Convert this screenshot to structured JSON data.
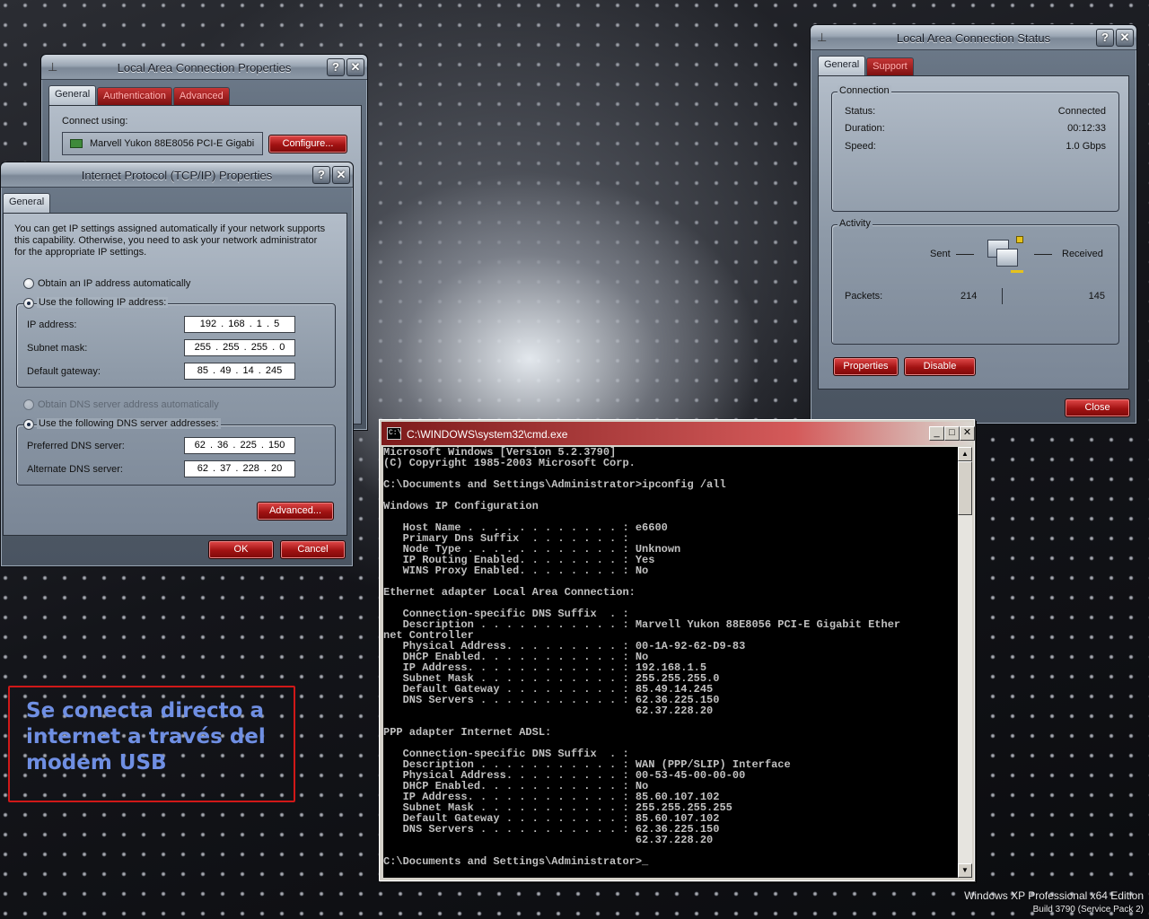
{
  "lan_properties": {
    "title": "Local Area Connection Properties",
    "tabs": [
      "General",
      "Authentication",
      "Advanced"
    ],
    "connect_using_label": "Connect using:",
    "adapter": "Marvell Yukon 88E8056 PCI-E Gigabi",
    "configure_button": "Configure..."
  },
  "tcpip": {
    "title": "Internet Protocol (TCP/IP) Properties",
    "tab": "General",
    "description": "You can get IP settings assigned automatically if your network supports this capability. Otherwise, you need to ask your network administrator for the appropriate IP settings.",
    "radio_auto_ip": "Obtain an IP address automatically",
    "radio_manual_ip": "Use the following IP address:",
    "ip_label": "IP address:",
    "ip_value": "192 . 168 .  1  .  5",
    "subnet_label": "Subnet mask:",
    "subnet_value": "255 . 255 . 255 .  0",
    "gateway_label": "Default gateway:",
    "gateway_value": "85  .  49  .  14  . 245",
    "radio_auto_dns": "Obtain DNS server address automatically",
    "radio_manual_dns": "Use the following DNS server addresses:",
    "pref_dns_label": "Preferred DNS server:",
    "pref_dns_value": "62  .  36  . 225 . 150",
    "alt_dns_label": "Alternate DNS server:",
    "alt_dns_value": "62  .  37  . 228 .  20",
    "advanced_button": "Advanced...",
    "ok_button": "OK",
    "cancel_button": "Cancel"
  },
  "status": {
    "title": "Local Area Connection Status",
    "tabs": [
      "General",
      "Support"
    ],
    "connection_group": "Connection",
    "status_label": "Status:",
    "status_value": "Connected",
    "duration_label": "Duration:",
    "duration_value": "00:12:33",
    "speed_label": "Speed:",
    "speed_value": "1.0 Gbps",
    "activity_group": "Activity",
    "sent_label": "Sent",
    "received_label": "Received",
    "packets_label": "Packets:",
    "packets_sent": "214",
    "packets_received": "145",
    "properties_button": "Properties",
    "disable_button": "Disable",
    "close_button": "Close"
  },
  "cmd": {
    "title": "C:\\WINDOWS\\system32\\cmd.exe",
    "icon_text": "C:\\",
    "lines": [
      "Microsoft Windows [Version 5.2.3790]",
      "(C) Copyright 1985-2003 Microsoft Corp.",
      "",
      "C:\\Documents and Settings\\Administrator>ipconfig /all",
      "",
      "Windows IP Configuration",
      "",
      "   Host Name . . . . . . . . . . . . : e6600",
      "   Primary Dns Suffix  . . . . . . . :",
      "   Node Type . . . . . . . . . . . . : Unknown",
      "   IP Routing Enabled. . . . . . . . : Yes",
      "   WINS Proxy Enabled. . . . . . . . : No",
      "",
      "Ethernet adapter Local Area Connection:",
      "",
      "   Connection-specific DNS Suffix  . :",
      "   Description . . . . . . . . . . . : Marvell Yukon 88E8056 PCI-E Gigabit Ether",
      "net Controller",
      "   Physical Address. . . . . . . . . : 00-1A-92-62-D9-83",
      "   DHCP Enabled. . . . . . . . . . . : No",
      "   IP Address. . . . . . . . . . . . : 192.168.1.5",
      "   Subnet Mask . . . . . . . . . . . : 255.255.255.0",
      "   Default Gateway . . . . . . . . . : 85.49.14.245",
      "   DNS Servers . . . . . . . . . . . : 62.36.225.150",
      "                                       62.37.228.20",
      "",
      "PPP adapter Internet ADSL:",
      "",
      "   Connection-specific DNS Suffix  . :",
      "   Description . . . . . . . . . . . : WAN (PPP/SLIP) Interface",
      "   Physical Address. . . . . . . . . : 00-53-45-00-00-00",
      "   DHCP Enabled. . . . . . . . . . . : No",
      "   IP Address. . . . . . . . . . . . : 85.60.107.102",
      "   Subnet Mask . . . . . . . . . . . : 255.255.255.255",
      "   Default Gateway . . . . . . . . . : 85.60.107.102",
      "   DNS Servers . . . . . . . . . . . : 62.36.225.150",
      "                                       62.37.228.20",
      "",
      "C:\\Documents and Settings\\Administrator>_"
    ]
  },
  "caption": "Se conecta directo a\ninternet a través del\nmodem USB",
  "os": {
    "edition": "Windows XP Professional x64 Edition",
    "build": "Build 3790 (Service Pack 2)"
  },
  "colors": {
    "accent_red": "#b01515",
    "caption_text": "#6f8fe3",
    "caption_border": "#d01818"
  },
  "icons": {
    "window_icon": "network-connection-icon",
    "help": "help-icon",
    "close": "close-icon"
  }
}
